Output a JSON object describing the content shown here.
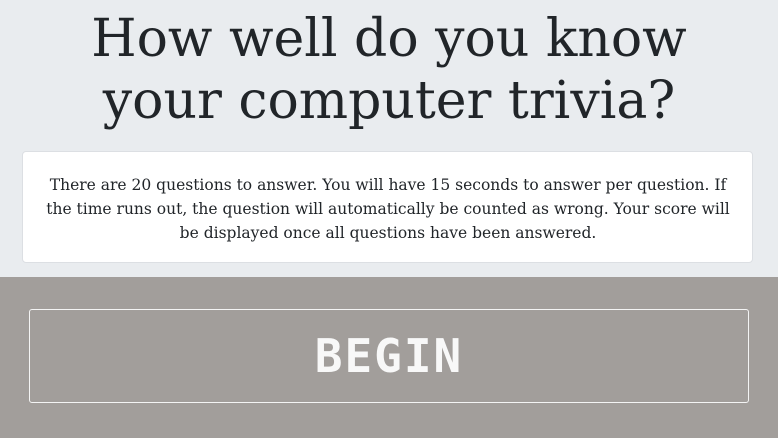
{
  "hero": {
    "title_line_1": "How well do you know",
    "title_line_2": "your computer trivia?"
  },
  "info": {
    "text": "There are 20 questions to answer. You will have 15 seconds to answer per question. If the time runs out, the question will automatically be counted as wrong. Your score will be displayed once all questions have been answered."
  },
  "actions": {
    "begin_label": "BEGIN"
  },
  "colors": {
    "page_background": "#e9ecef",
    "footer_background": "#a29e9b",
    "card_background": "#ffffff",
    "text": "#212529",
    "button_text": "#f8f8f8"
  }
}
